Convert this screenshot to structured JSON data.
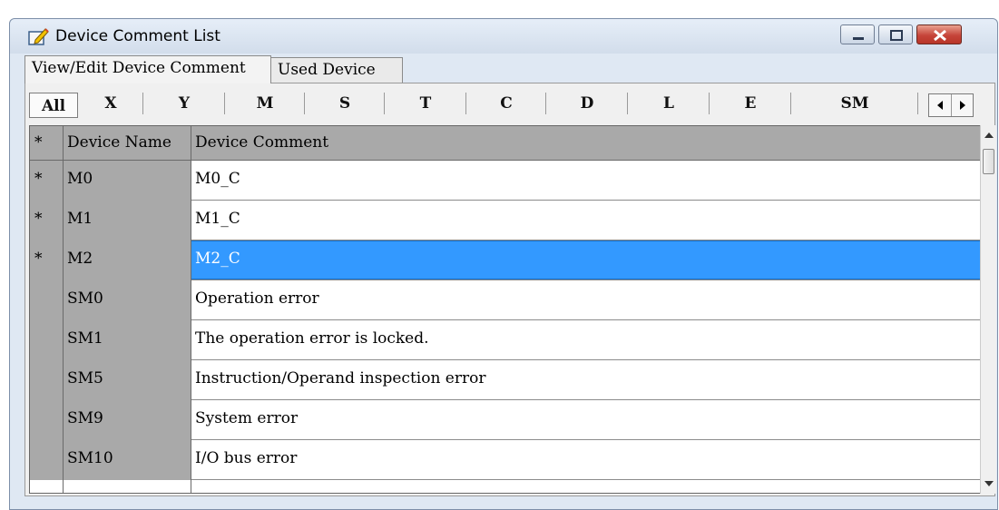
{
  "window": {
    "title": "Device Comment List",
    "icon": "edit-pencil-icon"
  },
  "tabs": [
    {
      "label": "View/Edit Device Comment",
      "active": true
    },
    {
      "label": "Used Device",
      "active": false
    }
  ],
  "filters": [
    "All",
    "X",
    "Y",
    "M",
    "S",
    "T",
    "C",
    "D",
    "L",
    "E",
    "SM"
  ],
  "selected_filter": "All",
  "table": {
    "headers": {
      "marker": "*",
      "name": "Device Name",
      "comment": "Device Comment"
    },
    "rows": [
      {
        "marker": "*",
        "name": "M0",
        "comment": "M0_C"
      },
      {
        "marker": "*",
        "name": "M1",
        "comment": "M1_C"
      },
      {
        "marker": "*",
        "name": "M2",
        "comment": "M2_C",
        "selected": true
      },
      {
        "marker": "",
        "name": "SM0",
        "comment": "Operation error"
      },
      {
        "marker": "",
        "name": "SM1",
        "comment": "The operation error is locked."
      },
      {
        "marker": "",
        "name": "SM5",
        "comment": "Instruction/Operand inspection error"
      },
      {
        "marker": "",
        "name": "SM9",
        "comment": "System error"
      },
      {
        "marker": "",
        "name": "SM10",
        "comment": "I/O bus error"
      }
    ]
  },
  "colors": {
    "selection": "#3399ff",
    "header_gray": "#a9a9a9",
    "close_button": "#c6453a"
  }
}
